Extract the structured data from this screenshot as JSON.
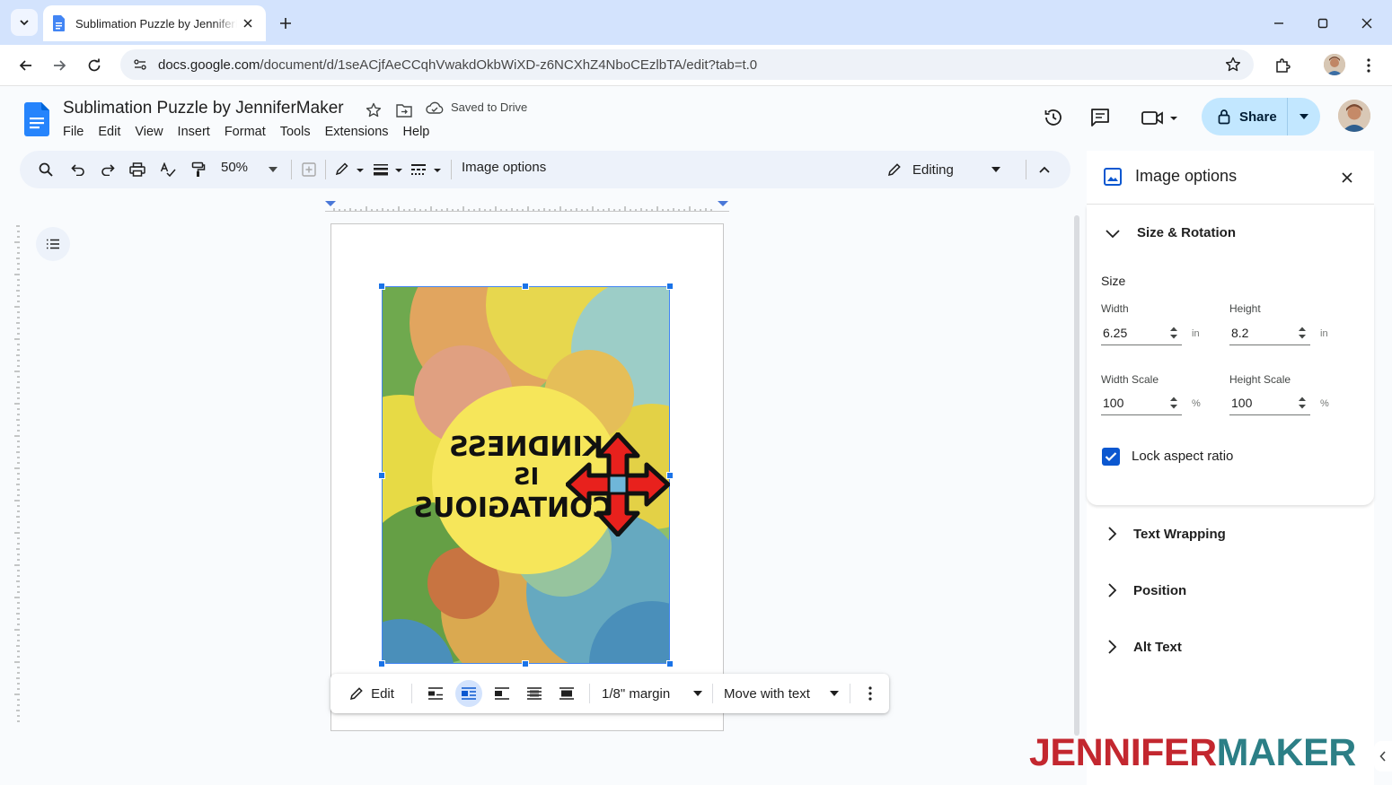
{
  "browser": {
    "tab_title": "Sublimation Puzzle by JenniferMaker",
    "url_host": "docs.google.com",
    "url_path": "/document/d/1seACjfAeCCqhVwakdOkbWiXD-z6NCXhZ4NboCEzlbTA/edit?tab=t.0"
  },
  "docs": {
    "title": "Sublimation Puzzle by JenniferMaker",
    "saved_status": "Saved to Drive",
    "menu": [
      "File",
      "Edit",
      "View",
      "Insert",
      "Format",
      "Tools",
      "Extensions",
      "Help"
    ],
    "share_label": "Share",
    "accent": "#c2e7ff"
  },
  "toolbar": {
    "zoom": "50%",
    "image_options_label": "Image options",
    "mode_label": "Editing"
  },
  "image": {
    "text_lines": [
      "KINDNESS",
      "IS",
      "CONTAGIOUS"
    ]
  },
  "float_toolbar": {
    "edit_label": "Edit",
    "margin_label": "1/8\" margin",
    "move_label": "Move with text"
  },
  "panel": {
    "title": "Image options",
    "size_rotation": {
      "heading": "Size & Rotation",
      "size_label": "Size",
      "width_label": "Width",
      "width_value": "6.25",
      "height_label": "Height",
      "height_value": "8.2",
      "unit_in": "in",
      "width_scale_label": "Width Scale",
      "width_scale_value": "100",
      "height_scale_label": "Height Scale",
      "height_scale_value": "100",
      "unit_pct": "%",
      "lock_label": "Lock aspect ratio",
      "lock_checked": true
    },
    "sections": [
      "Text Wrapping",
      "Position",
      "Alt Text"
    ]
  },
  "watermark": {
    "part1": "JENNIFER",
    "part2": "MAKER"
  }
}
